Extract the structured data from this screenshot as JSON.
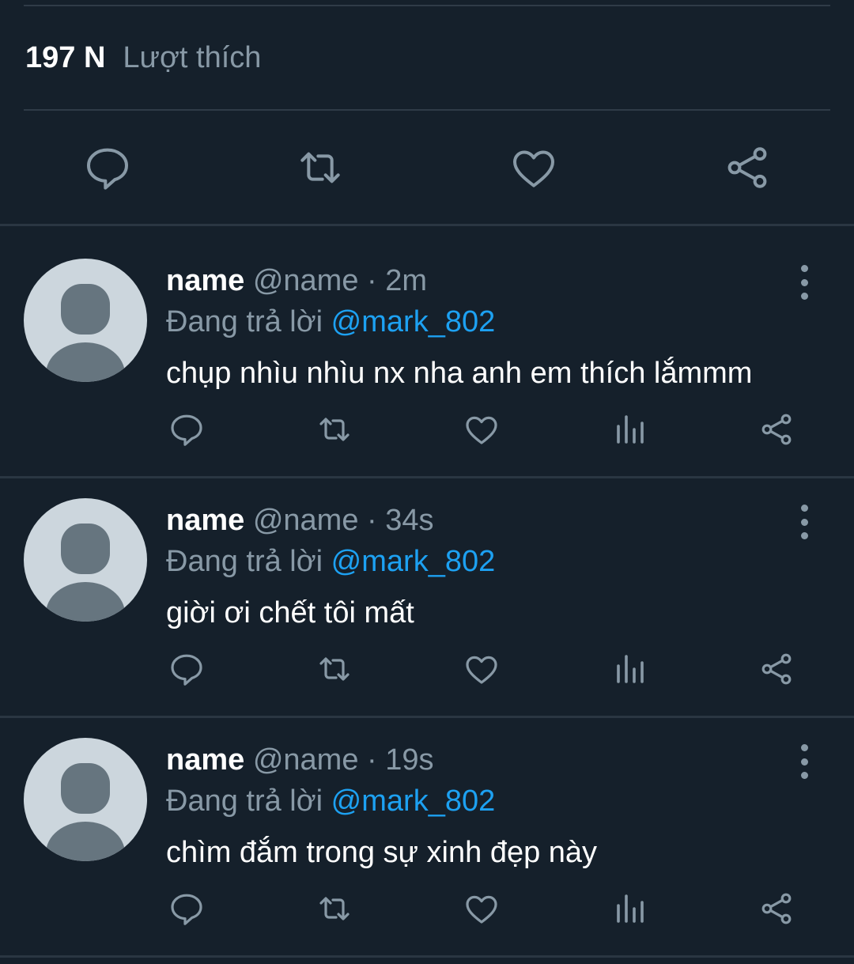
{
  "tweet_stats": {
    "likes_count": "197 N",
    "likes_label": "Lượt thích"
  },
  "tweet_actions": [
    "reply-icon",
    "retweet-icon",
    "like-icon",
    "share-icon"
  ],
  "replies": [
    {
      "name": "name",
      "handle": "@name",
      "separator": "·",
      "time": "2m",
      "replying_prefix": "Đang trả lời",
      "mention": "@mark_802",
      "text": "chụp nhìu nhìu nx nha anh em thích lắmmm"
    },
    {
      "name": "name",
      "handle": "@name",
      "separator": "·",
      "time": "34s",
      "replying_prefix": "Đang trả lời",
      "mention": "@mark_802",
      "text": "giời ơi chết tôi mất"
    },
    {
      "name": "name",
      "handle": "@name",
      "separator": "·",
      "time": "19s",
      "replying_prefix": "Đang trả lời",
      "mention": "@mark_802",
      "text": "chìm đắm trong sự xinh đẹp này"
    }
  ],
  "colors": {
    "background": "#15202b",
    "text": "#ffffff",
    "muted": "#8899a6",
    "accent": "#1da1f2",
    "divider": "#2f3b47"
  }
}
